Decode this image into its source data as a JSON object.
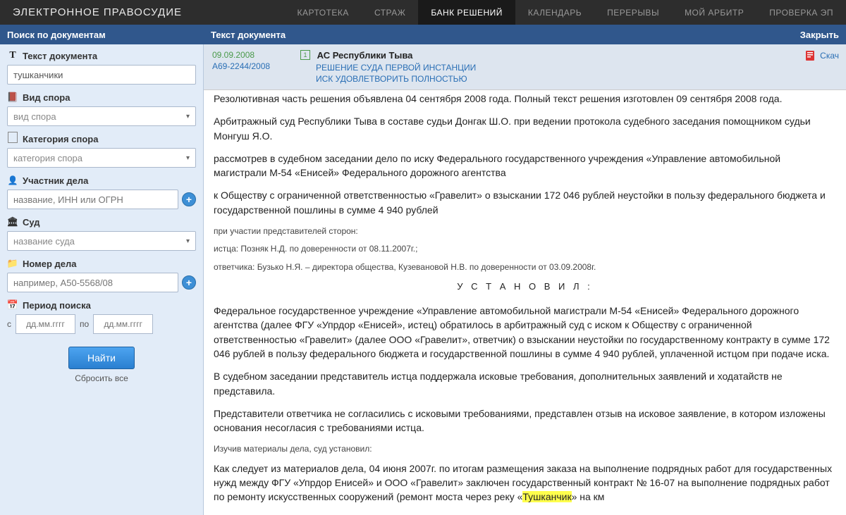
{
  "app_title": "ЭЛЕКТРОННОЕ ПРАВОСУДИЕ",
  "nav": {
    "items": [
      "КАРТОТЕКА",
      "СТРАЖ",
      "БАНК РЕШЕНИЙ",
      "КАЛЕНДАРЬ",
      "ПЕРЕРЫВЫ",
      "МОЙ АРБИТР",
      "ПРОВЕРКА ЭП"
    ],
    "active": 2
  },
  "subbar": {
    "left": "Поиск по документам",
    "mid": "Текст документа",
    "right": "Закрыть"
  },
  "filters": {
    "text_label": "Текст документа",
    "text_value": "тушканчики",
    "dispute_label": "Вид спора",
    "dispute_placeholder": "вид спора",
    "category_label": "Категория спора",
    "category_placeholder": "категория спора",
    "party_label": "Участник дела",
    "party_placeholder": "название, ИНН или ОГРН",
    "court_label": "Суд",
    "court_placeholder": "название суда",
    "case_label": "Номер дела",
    "case_placeholder": "например, А50-5568/08",
    "period_label": "Период поиска",
    "from_label": "с",
    "to_label": "по",
    "date_placeholder": "дд.мм.гггг",
    "find_btn": "Найти",
    "reset": "Сбросить все"
  },
  "doc_header": {
    "date": "09.09.2008",
    "case_no": "А69-2244/2008",
    "badge": "1",
    "court": "АС Республики Тыва",
    "doc_type": "РЕШЕНИЕ СУДА ПЕРВОЙ ИНСТАНЦИИ",
    "result": "ИСК УДОВЛЕТВОРИТЬ ПОЛНОСТЬЮ",
    "download": "Скач"
  },
  "body": {
    "p0": "Резолютивная часть решения объявлена 04 сентября 2008 года. Полный текст решения изготовлен 09 сентября 2008 года.",
    "p1": "Арбитражный суд Республики Тыва в составе судьи Донгак Ш.О. при ведении протокола судебного заседания помощником судьи Монгуш Я.О.",
    "p2": "рассмотрев в судебном заседании дело по иску Федерального государственного учреждения «Управление автомобильной магистрали М-54 «Енисей» Федерального дорожного агентства",
    "p3": "к Обществу с ограниченной ответственностью «Гравелит» о взыскании 172 046 рублей неустойки в пользу федерального бюджета и государственной пошлины в сумме 4 940 рублей",
    "s1": "при участии представителей сторон:",
    "s2": "истца: Позняк Н.Д. по доверенности от 08.11.2007г.;",
    "s3": "ответчика: Бузько Н.Я. – директора общества, Кузевановой Н.В. по доверенности от 03.09.2008г.",
    "ust": "У С Т А Н О В И Л :",
    "p4": "Федеральное государственное учреждение «Управление автомобильной магистрали М-54 «Енисей» Федерального дорожного агентства (далее ФГУ «Упрдор «Енисей», истец) обратилось в арбитражный суд с иском к Обществу с ограниченной ответственностью «Гравелит» (далее ООО «Гравелит», ответчик) о взыскании неустойки по государственному контракту в сумме 172 046 рублей в пользу федерального бюджета и государственной пошлины в сумме 4 940 рублей, уплаченной истцом при подаче иска.",
    "p5": "В судебном заседании представитель истца поддержала исковые требования, дополнительных заявлений и ходатайств не представила.",
    "p6": "Представители ответчика не согласились с исковыми требованиями, представлен отзыв на исковое заявление, в котором изложены основания несогласия с требованиями истца.",
    "s4": "Изучив материалы дела, суд установил:",
    "p7a": "Как следует из материалов дела, 04 июня 2007г. по итогам размещения заказа на выполнение подрядных работ для государственных нужд между ФГУ «Упрдор Енисей» и ООО «Гравелит» заключен государственный контракт № 16-07 на выполнение подрядных работ по ремонту искусственных сооружений (ремонт моста через реку «",
    "hl": "Тушканчик",
    "p7b": "» на км"
  }
}
